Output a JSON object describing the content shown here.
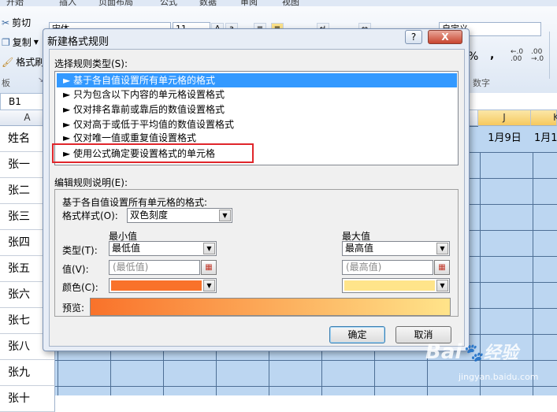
{
  "ribbon": {
    "tabs": [
      "开始",
      "插入",
      "页面布局",
      "公式",
      "数据",
      "审阅",
      "视图"
    ],
    "cut_label": "剪切",
    "copy_label": "复制",
    "format_painter_label": "格式刷",
    "clipboard_group": "板",
    "font_name": "宋体",
    "font_size": "11",
    "number_format": "自定义",
    "number_group": "数字",
    "percent_symbol": "%",
    "comma_symbol": ","
  },
  "sheet": {
    "name_box": "B1",
    "col_a": "A",
    "col_j": "J",
    "col_k": "K",
    "rows": [
      "姓名",
      "张一",
      "张二",
      "张三",
      "张四",
      "张五",
      "张六",
      "张七",
      "张八",
      "张九",
      "张十"
    ],
    "date_j": "1月9日",
    "date_k": "1月1"
  },
  "dialog": {
    "title": "新建格式规则",
    "help": "?",
    "close": "X",
    "rule_type_label": "选择规则类型(S):",
    "rules": [
      "► 基于各自值设置所有单元格的格式",
      "► 只为包含以下内容的单元格设置格式",
      "► 仅对排名靠前或靠后的数值设置格式",
      "► 仅对高于或低于平均值的数值设置格式",
      "► 仅对唯一值或重复值设置格式",
      "► 使用公式确定要设置格式的单元格"
    ],
    "edit_label": "编辑规则说明(E):",
    "desc_heading": "基于各自值设置所有单元格的格式:",
    "style_label": "格式样式(O):",
    "style_value": "双色刻度",
    "min_header": "最小值",
    "max_header": "最大值",
    "type_label": "类型(T):",
    "value_label": "值(V):",
    "color_label": "颜色(C):",
    "min_type": "最低值",
    "max_type": "最高值",
    "min_value_placeholder": "(最低值)",
    "max_value_placeholder": "(最高值)",
    "preview_label": "预览:",
    "ok": "确定",
    "cancel": "取消"
  },
  "colors": {
    "min_color": "#f9722a",
    "max_color": "#ffe48a",
    "selection": "#3399ff",
    "highlight_box": "#e0262b"
  },
  "watermark": {
    "brand": "Bai",
    "brand2": "经验",
    "url": "jingyan.baidu.com"
  }
}
